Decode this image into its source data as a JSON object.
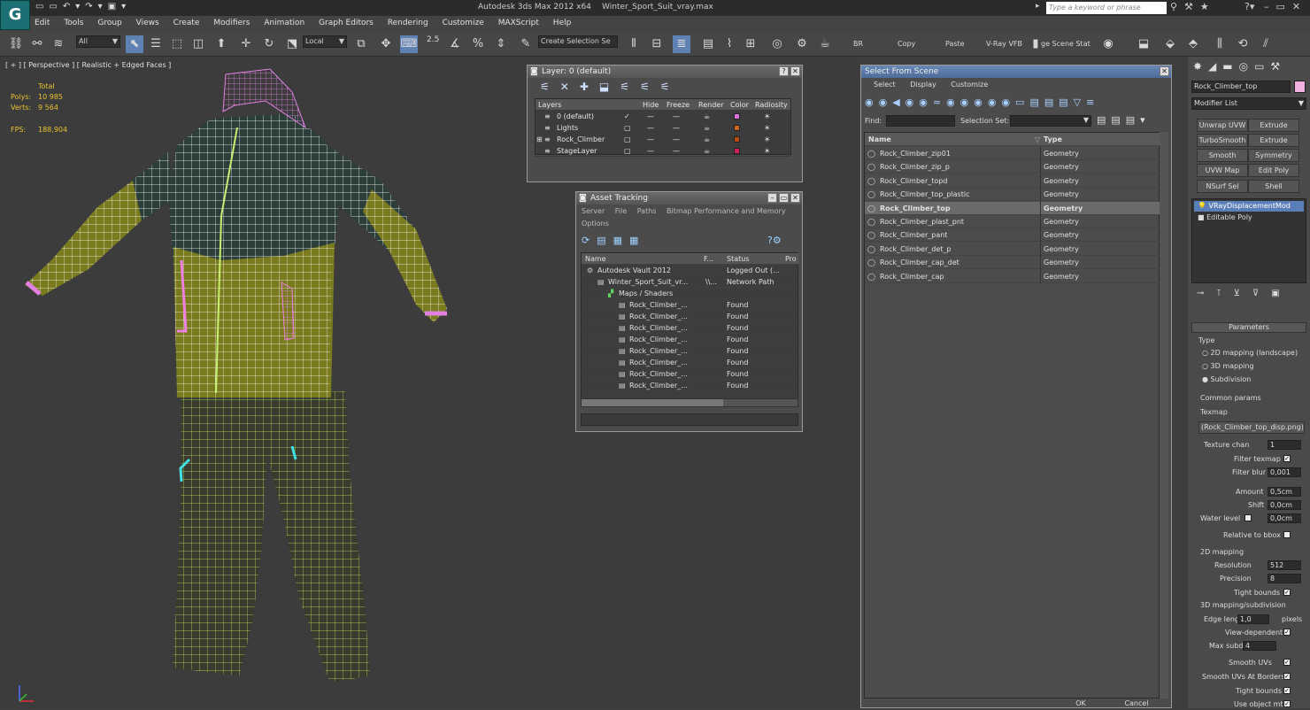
{
  "app": {
    "title": "Autodesk 3ds Max  2012 x64",
    "file": "Winter_Sport_Suit_vray.max",
    "logo": "3ds-max-logo",
    "search_placeholder": "Type a keyword or phrase"
  },
  "menu": [
    "Edit",
    "Tools",
    "Group",
    "Views",
    "Create",
    "Modifiers",
    "Animation",
    "Graph Editors",
    "Rendering",
    "Customize",
    "MAXScript",
    "Help"
  ],
  "toolbar": {
    "filter": "All",
    "coord": "Local",
    "snap_angle": "2.5",
    "named_sel": "Create Selection Se",
    "br": "BR",
    "copy": "Copy",
    "paste": "Paste",
    "vray_vfb": "V-Ray VFB",
    "scene_state": "ge Scene Stat"
  },
  "viewport": {
    "label": "[ + ] [ Perspective ] [ Realistic + Edged Faces ]",
    "stats_header": "Total",
    "polys_label": "Polys:",
    "polys": "10 985",
    "verts_label": "Verts:",
    "verts": "9 564",
    "fps_label": "FPS:",
    "fps": "188,904"
  },
  "layer_window": {
    "title": "Layer: 0 (default)",
    "headers": [
      "Layers",
      "Hide",
      "Freeze",
      "Render",
      "Color",
      "Radiosity"
    ],
    "rows": [
      {
        "name": "0 (default)",
        "current": "✓",
        "color": "#e070e0"
      },
      {
        "name": "Lights",
        "current": "",
        "color": "#c8641e"
      },
      {
        "name": "Rock_Climber",
        "current": "",
        "color": "#b84a10"
      },
      {
        "name": "StageLayer",
        "current": "",
        "color": "#d0205a"
      }
    ]
  },
  "asset_tracking": {
    "title": "Asset Tracking",
    "menu": [
      "Server",
      "File",
      "Paths",
      "Bitmap Performance and Memory"
    ],
    "menu2": "Options",
    "headers": [
      "Name",
      "F...",
      "Status",
      "Pro"
    ],
    "rows": [
      {
        "name": "Autodesk Vault 2012",
        "f": "",
        "status": "Logged Out (..."
      },
      {
        "name": "Winter_Sport_Suit_vr...",
        "f": "\\\\...",
        "status": "Network Path"
      },
      {
        "name": "Maps / Shaders",
        "f": "",
        "status": ""
      },
      {
        "name": "Rock_Climber_...",
        "f": "",
        "status": "Found"
      },
      {
        "name": "Rock_Climber_...",
        "f": "",
        "status": "Found"
      },
      {
        "name": "Rock_Climber_...",
        "f": "",
        "status": "Found"
      },
      {
        "name": "Rock_Climber_...",
        "f": "",
        "status": "Found"
      },
      {
        "name": "Rock_Climber_...",
        "f": "",
        "status": "Found"
      },
      {
        "name": "Rock_Climber_...",
        "f": "",
        "status": "Found"
      },
      {
        "name": "Rock_Climber_...",
        "f": "",
        "status": "Found"
      },
      {
        "name": "Rock_Climber_...",
        "f": "",
        "status": "Found"
      }
    ]
  },
  "select_scene": {
    "title": "Select From Scene",
    "menu": [
      "Select",
      "Display",
      "Customize"
    ],
    "find_label": "Find:",
    "selset_label": "Selection Set:",
    "headers": [
      "Name",
      "Type"
    ],
    "rows": [
      {
        "name": "Rock_Climber_zip01",
        "type": "Geometry"
      },
      {
        "name": "Rock_Climber_zip_p",
        "type": "Geometry"
      },
      {
        "name": "Rock_Climber_topd",
        "type": "Geometry"
      },
      {
        "name": "Rock_Climber_top_plastic",
        "type": "Geometry"
      },
      {
        "name": "Rock_Climber_top",
        "type": "Geometry"
      },
      {
        "name": "Rock_Climber_plast_pnt",
        "type": "Geometry"
      },
      {
        "name": "Rock_Climber_pant",
        "type": "Geometry"
      },
      {
        "name": "Rock_Climber_det_p",
        "type": "Geometry"
      },
      {
        "name": "Rock_Climber_cap_det",
        "type": "Geometry"
      },
      {
        "name": "Rock_Climber_cap",
        "type": "Geometry"
      }
    ],
    "selected_index": 4,
    "ok": "OK",
    "cancel": "Cancel"
  },
  "command_panel": {
    "object_name": "Rock_Climber_top",
    "object_color": "#f0b0e0",
    "modifier_list": "Modifier List",
    "buttons": [
      "Unwrap UVW",
      "Extrude",
      "TurboSmooth",
      "Extrude",
      "Smooth",
      "Symmetry",
      "UVW Map",
      "Edit Poly",
      "NSurf Sel",
      "Shell"
    ],
    "stack": [
      "VRayDisplacementMod",
      "Editable Poly"
    ],
    "params_title": "Parameters",
    "type_label": "Type",
    "type_options": [
      "2D mapping (landscape)",
      "3D mapping",
      "Subdivision"
    ],
    "common_label": "Common params",
    "texmap_label": "Texmap",
    "texmap": "(Rock_Climber_top_disp.png)",
    "texture_chan_label": "Texture chan",
    "texture_chan": "1",
    "filter_texmap": "Filter texmap",
    "filter_blur_label": "Filter blur",
    "filter_blur": "0,001",
    "amount_label": "Amount",
    "amount": "0,5cm",
    "shift_label": "Shift",
    "shift": "0,0cm",
    "water_label": "Water level",
    "water": "0,0cm",
    "relative": "Relative to bbox",
    "map2d_label": "2D mapping",
    "resolution_label": "Resolution",
    "resolution": "512",
    "precision_label": "Precision",
    "precision": "8",
    "tight_bounds": "Tight bounds",
    "map3d_label": "3D mapping/subdivision",
    "edge_label": "Edge length",
    "edge": "1,0",
    "pixels": "pixels",
    "view_dep": "View-dependent",
    "max_subdivs_label": "Max subdivs",
    "max_subdivs": "4",
    "smooth_uvs": "Smooth UVs",
    "smooth_borders": "Smooth UVs At Borders",
    "tight_bounds2": "Tight bounds",
    "use_obj_mtl": "Use object mtl"
  }
}
